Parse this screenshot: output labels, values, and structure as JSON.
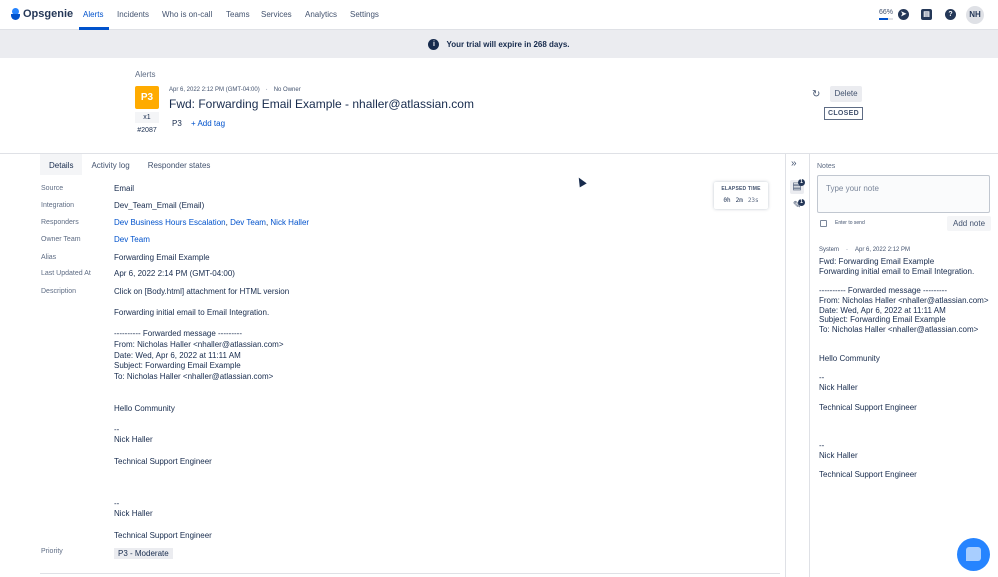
{
  "nav": {
    "brand": "Opsgenie",
    "items": [
      "Alerts",
      "Incidents",
      "Who is on-call",
      "Teams",
      "Services",
      "Analytics",
      "Settings"
    ],
    "progress_label": "66%",
    "progress_value": 0.66,
    "avatar_initials": "NH",
    "icons": [
      "compass-icon",
      "book-icon",
      "help-icon"
    ]
  },
  "banner": {
    "text": "Your trial will expire in 268 days."
  },
  "alert": {
    "breadcrumb": "Alerts",
    "priority": "P3",
    "count": "x1",
    "tiny_id": "#2087",
    "created": "Apr 6, 2022 2:12 PM (GMT-04:00)",
    "owner": "No Owner",
    "title": "Fwd: Forwarding Email Example - nhaller@atlassian.com",
    "tag": "P3",
    "add_tag": "+ Add tag",
    "delete_label": "Delete",
    "status": "CLOSED"
  },
  "tabs": [
    "Details",
    "Activity log",
    "Responder states"
  ],
  "details": {
    "labels": {
      "source": "Source",
      "integration": "Integration",
      "responders": "Responders",
      "owner_team": "Owner Team",
      "alias": "Alias",
      "last_updated": "Last Updated At",
      "description": "Description",
      "priority": "Priority"
    },
    "source": "Email",
    "integration": "Dev_Team_Email (Email)",
    "responders": [
      "Dev Business Hours Escalation",
      "Dev Team",
      "Nick Haller"
    ],
    "owner_team": "Dev Team",
    "alias": "Forwarding Email Example",
    "last_updated": "Apr 6, 2022 2:14 PM (GMT-04:00)",
    "description": "Click on [Body.html] attachment for HTML version\n\nForwarding initial email to Email Integration.\n\n---------- Forwarded message ---------\nFrom: Nicholas Haller <nhaller@atlassian.com>\nDate: Wed, Apr 6, 2022 at 11:11 AM\nSubject: Forwarding Email Example\nTo: Nicholas Haller <nhaller@atlassian.com>\n\n\nHello Community\n\n--\nNick Haller\n\nTechnical Support Engineer\n\n\n\n--\nNick Haller\n\nTechnical Support Engineer",
    "priority": "P3 - Moderate"
  },
  "elapsed": {
    "title": "ELAPSED TIME",
    "hours": "0h",
    "minutes": "2m",
    "seconds": "23s"
  },
  "rail": {
    "notes_badge": "1",
    "attachments_badge": "1"
  },
  "notes": {
    "title": "Notes",
    "placeholder": "Type your note",
    "enter_to_send": "Enter to send",
    "add_note": "Add note",
    "entry": {
      "author": "System",
      "time": "Apr 6, 2022 2:12 PM",
      "body": "Fwd: Forwarding Email Example\nForwarding initial email to Email Integration.\n\n---------- Forwarded message ---------\nFrom: Nicholas Haller <nhaller@atlassian.com>\nDate: Wed, Apr 6, 2022 at 11:11 AM\nSubject: Forwarding Email Example\nTo: Nicholas Haller <nhaller@atlassian.com>\n\n\nHello Community\n\n--\nNick Haller\n\nTechnical Support Engineer\n\n\n\n--\nNick Haller\n\nTechnical Support Engineer"
    }
  },
  "colors": {
    "accent": "#0052cc",
    "priority_p3": "#ffab00",
    "banner_bg": "#ebecf0"
  }
}
